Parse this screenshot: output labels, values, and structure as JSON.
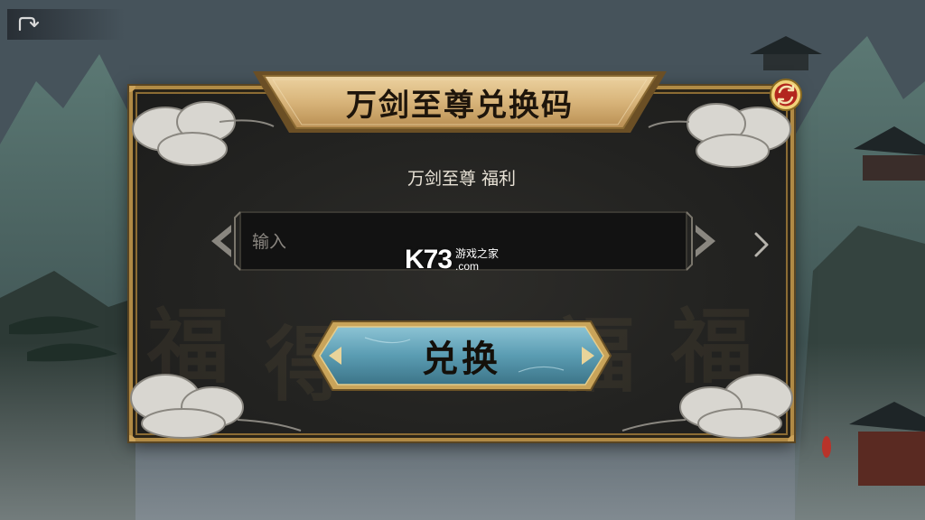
{
  "nav": {
    "back_icon": "back-arrow-icon"
  },
  "dialog": {
    "title": "万剑至尊兑换码",
    "subtitle": "万剑至尊 福利",
    "refresh_icon": "refresh-icon",
    "input": {
      "value": "",
      "placeholder": "输入"
    },
    "next_icon": "chevron-right-icon",
    "exchange_label": "兑换"
  },
  "watermark": {
    "logo": "K73",
    "site_name": "游戏之家",
    "domain": ".com"
  },
  "colors": {
    "gold_frame": "#b08a45",
    "panel_bg": "#232321",
    "button_blue": "#4f8fa6",
    "refresh_red": "#b3261e"
  }
}
